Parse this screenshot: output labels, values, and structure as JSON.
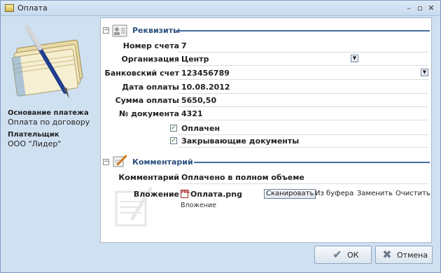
{
  "window": {
    "title": "Оплата"
  },
  "left": {
    "basis_label": "Основание платежа",
    "basis_value": "Оплата по договору",
    "payer_label": "Плательщик",
    "payer_value": "ООО \"Лидер\""
  },
  "sections": {
    "details_title": "Реквизиты",
    "comment_title": "Комментарий"
  },
  "fields": [
    {
      "label": "Номер счета",
      "value": "7"
    },
    {
      "label": "Организация",
      "value": "Центр"
    },
    {
      "label": "Банковский счет",
      "value": "123456789"
    },
    {
      "label": "Дата оплаты",
      "value": "10.08.2012"
    },
    {
      "label": "Сумма оплаты",
      "value": "5650,50"
    },
    {
      "label": "№ документа",
      "value": "4321"
    }
  ],
  "checkboxes": [
    {
      "label": "Оплачен",
      "checked": true
    },
    {
      "label": "Закрывающие документы",
      "checked": true
    }
  ],
  "comment": {
    "label": "Комментарий",
    "value": "Оплачено в полном объеме"
  },
  "attachment": {
    "label": "Вложение",
    "file_name": "Оплата.png",
    "file_icon_text": "PNG",
    "actions": [
      "Сканировать",
      "Из буфера",
      "Заменить",
      "Очистить"
    ],
    "separator": "·",
    "hint": "Вложение"
  },
  "buttons": {
    "ok": "ОК",
    "cancel": "Отмена"
  },
  "icons": {
    "app": "receipt-icon",
    "details": "contact-card-icon",
    "comment": "pencil-note-icon",
    "ok": "checkmark-icon",
    "cancel": "close-icon"
  },
  "colors": {
    "section_title": "#2b4f7e",
    "frame": "#cfe0f1",
    "check": "#1c6b1c"
  }
}
